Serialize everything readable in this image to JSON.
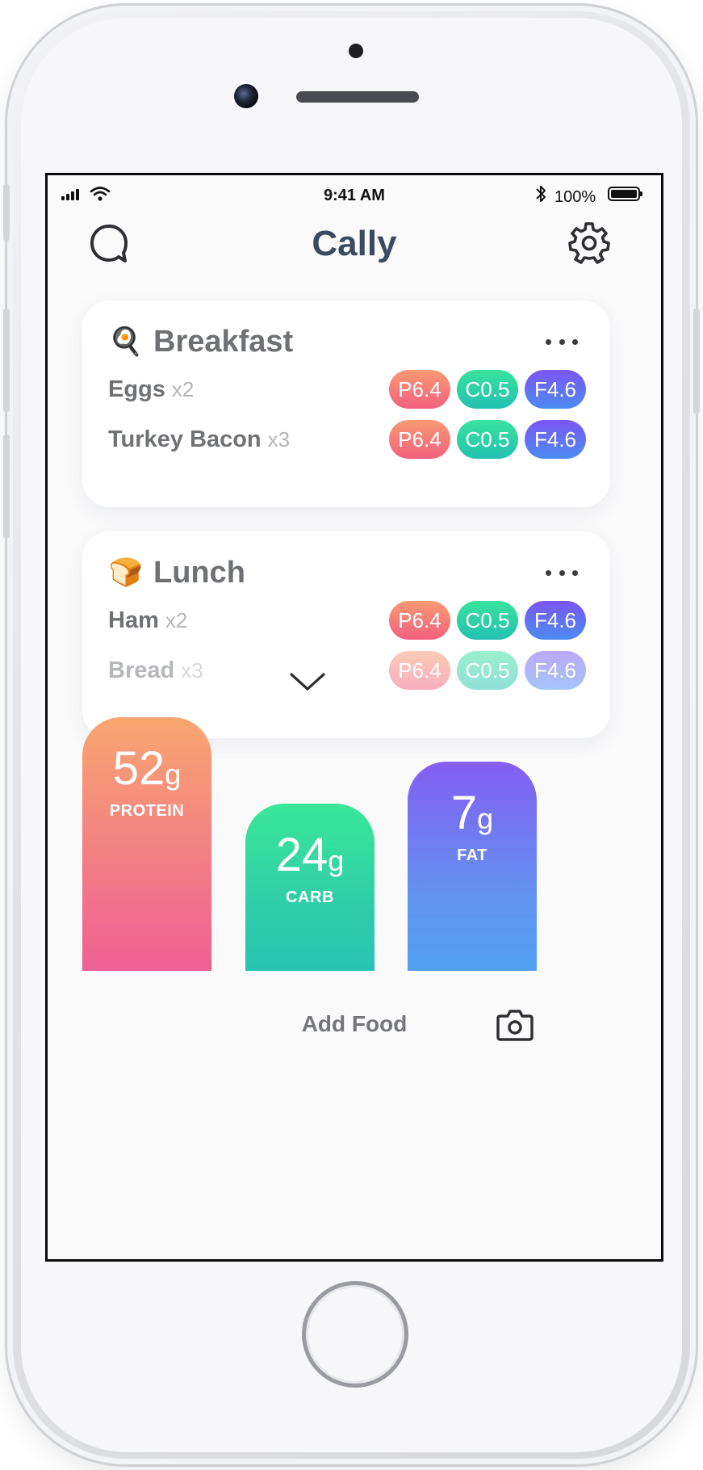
{
  "status_bar": {
    "time": "9:41 AM",
    "battery": "100%"
  },
  "header": {
    "title": "Cally",
    "search_icon": "search-bubble-icon",
    "settings_icon": "gear-icon"
  },
  "meals": [
    {
      "name": "Breakfast",
      "emoji": "🍳",
      "items": [
        {
          "name": "Eggs",
          "qty": "x2",
          "protein": "P6.4",
          "carb": "C0.5",
          "fat": "F4.6"
        },
        {
          "name": "Turkey Bacon",
          "qty": "x3",
          "protein": "P6.4",
          "carb": "C0.5",
          "fat": "F4.6"
        }
      ]
    },
    {
      "name": "Lunch",
      "emoji": "🍞",
      "items": [
        {
          "name": "Ham",
          "qty": "x2",
          "protein": "P6.4",
          "carb": "C0.5",
          "fat": "F4.6"
        },
        {
          "name": "Bread",
          "qty": "x3",
          "protein": "P6.4",
          "carb": "C0.5",
          "fat": "F4.6"
        }
      ]
    }
  ],
  "totals": [
    {
      "value": "52",
      "unit": "g",
      "label": "PROTEIN"
    },
    {
      "value": "24",
      "unit": "g",
      "label": "CARB"
    },
    {
      "value": "7",
      "unit": "g",
      "label": "FAT"
    }
  ],
  "bottom": {
    "add_food": "Add Food",
    "camera_icon": "camera-icon"
  },
  "colors": {
    "title": "#3b4a63",
    "protein": [
      "#f89a72",
      "#f3607f"
    ],
    "carb": [
      "#39e29e",
      "#23c1b0"
    ],
    "fat": [
      "#7b55f2",
      "#4c8cf2"
    ]
  }
}
